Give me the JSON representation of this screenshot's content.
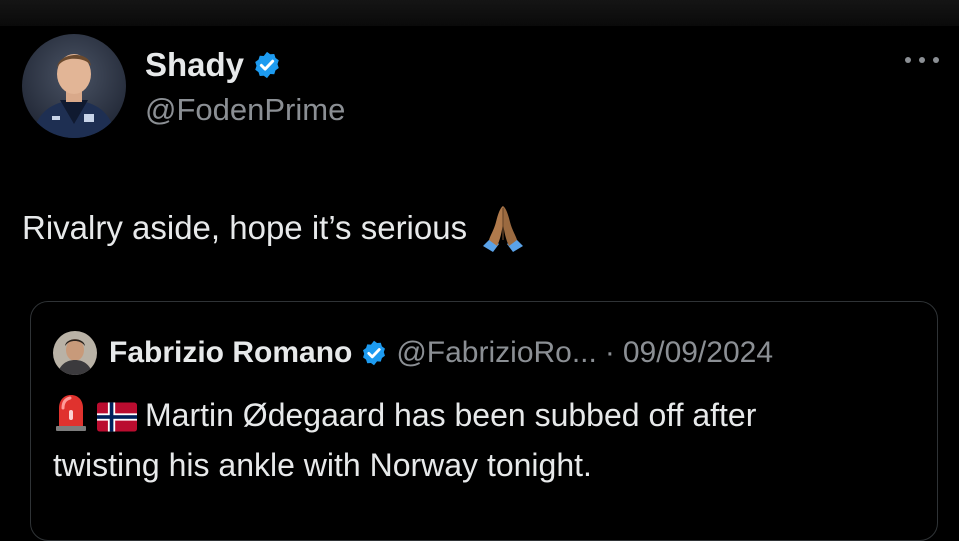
{
  "tweet": {
    "author": {
      "display_name": "Shady",
      "handle": "@FodenPrime",
      "verified": true,
      "avatar_icon": "profile-photo"
    },
    "text": "Rivalry aside, hope it’s serious",
    "emoji": "folded-hands-icon",
    "menu_icon": "more-options-icon"
  },
  "quote": {
    "author": {
      "display_name": "Fabrizio Romano",
      "handle": "@FabrizioRo...",
      "verified": true
    },
    "separator": "·",
    "date": "09/09/2024",
    "emojis": [
      "siren-icon",
      "norway-flag-icon"
    ],
    "text_line1": "Martin Ødegaard has been subbed off after",
    "text_line2": "twisting his ankle with Norway tonight."
  },
  "colors": {
    "background": "#000000",
    "text_primary": "#e7e9ea",
    "text_secondary": "#8b8f94",
    "verified_blue": "#1d9bf0",
    "border": "#2f3336"
  }
}
